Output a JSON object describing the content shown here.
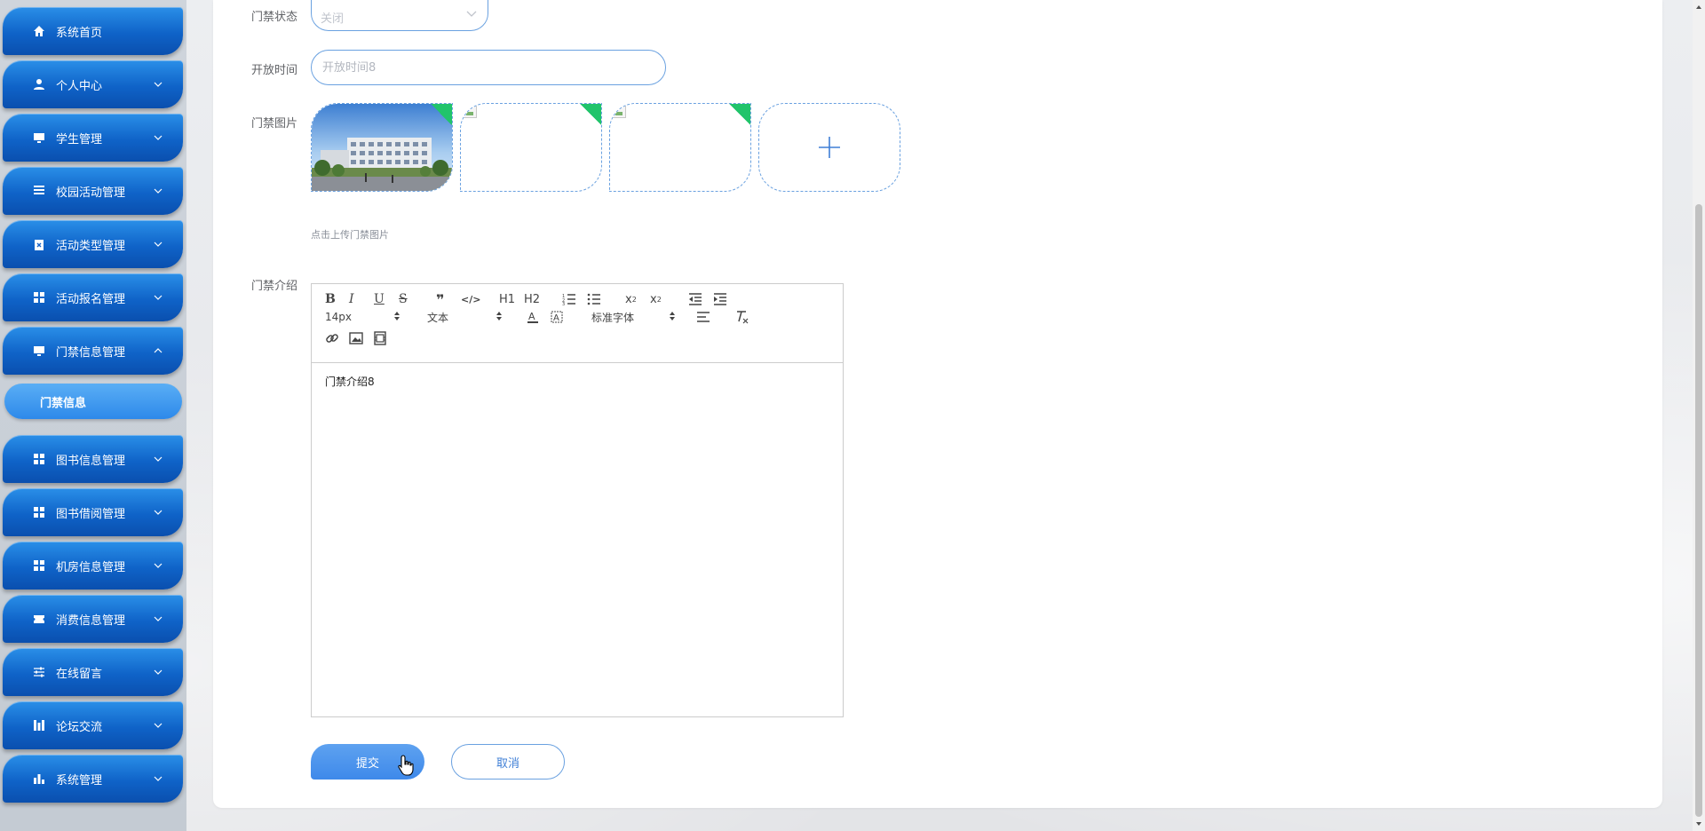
{
  "sidebar": {
    "items": [
      {
        "label": "系统首页",
        "icon": "home-icon",
        "expanded": null
      },
      {
        "label": "个人中心",
        "icon": "user-icon",
        "expanded": false
      },
      {
        "label": "学生管理",
        "icon": "monitor-icon",
        "expanded": false
      },
      {
        "label": "校园活动管理",
        "icon": "list-icon",
        "expanded": false
      },
      {
        "label": "活动类型管理",
        "icon": "clipboard-x-icon",
        "expanded": false
      },
      {
        "label": "活动报名管理",
        "icon": "grid-icon",
        "expanded": false
      },
      {
        "label": "门禁信息管理",
        "icon": "monitor-icon",
        "expanded": true
      },
      {
        "label": "图书信息管理",
        "icon": "grid-icon",
        "expanded": false
      },
      {
        "label": "图书借阅管理",
        "icon": "grid-icon",
        "expanded": false
      },
      {
        "label": "机房信息管理",
        "icon": "grid-icon",
        "expanded": false
      },
      {
        "label": "消费信息管理",
        "icon": "ticket-icon",
        "expanded": false
      },
      {
        "label": "在线留言",
        "icon": "sliders-icon",
        "expanded": false
      },
      {
        "label": "论坛交流",
        "icon": "bars-icon",
        "expanded": false
      },
      {
        "label": "系统管理",
        "icon": "bar-chart-icon",
        "expanded": false
      }
    ],
    "submenu": {
      "label": "门禁信息",
      "active": true
    }
  },
  "form": {
    "status_label": "门禁状态",
    "status_value": "关闭",
    "open_time_label": "开放时间",
    "open_time_placeholder": "开放时间8",
    "picture_label": "门禁图片",
    "upload_hint": "点击上传门禁图片",
    "intro_label": "门禁介绍",
    "intro_content": "门禁介绍8",
    "submit_label": "提交",
    "cancel_label": "取消"
  },
  "editor_toolbar": {
    "size_value": "14px",
    "header_value": "文本",
    "font_value": "标准字体",
    "h1": "H1",
    "h2": "H2"
  },
  "colors": {
    "accent": "#1f6fd6",
    "border": "#6aa1e0",
    "upload_corner": "#21c46b"
  }
}
